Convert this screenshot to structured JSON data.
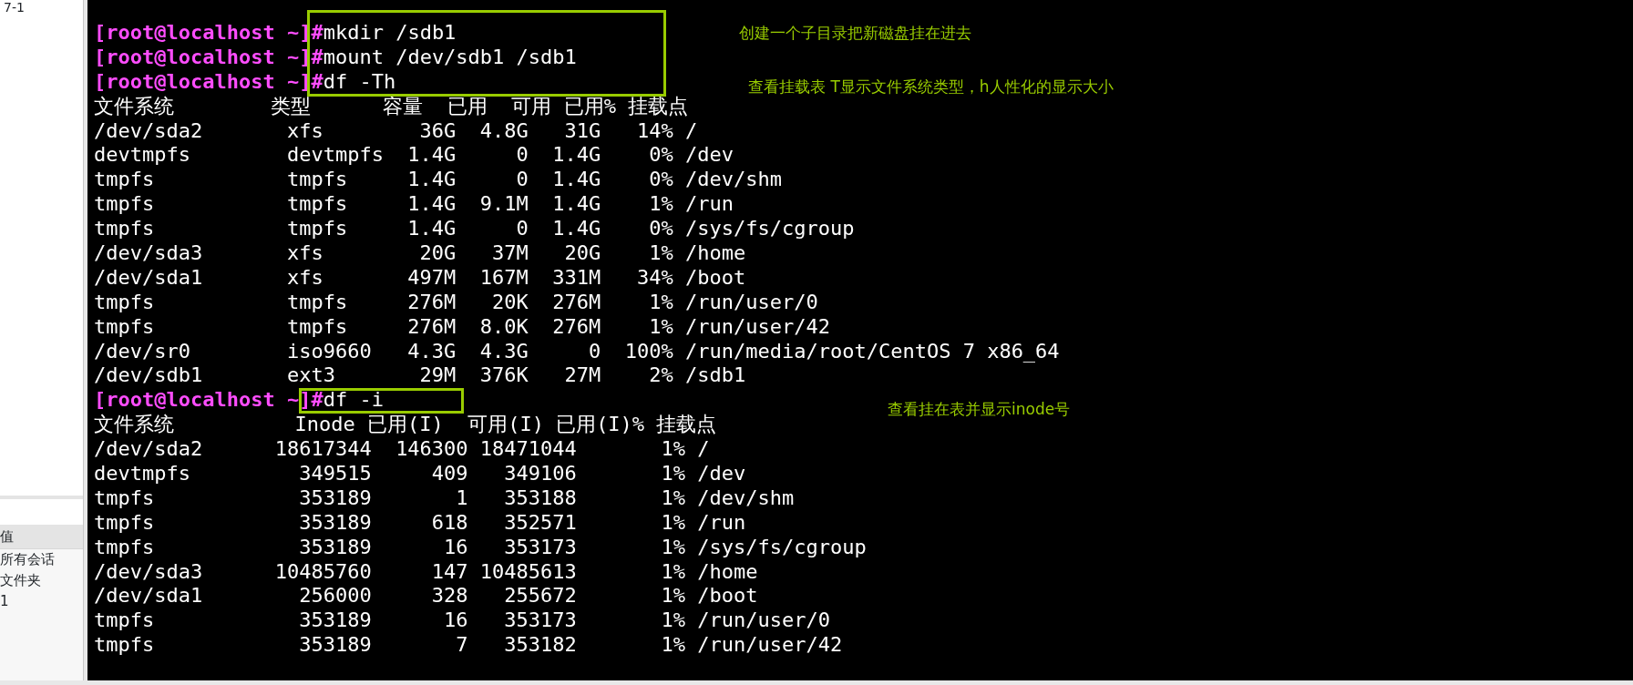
{
  "sidebar": {
    "top_text": "7-1",
    "header": "值",
    "items": [
      {
        "label": "所有会话"
      },
      {
        "label": "文件夹"
      },
      {
        "label": "1"
      }
    ]
  },
  "terminal": {
    "lines": [
      {
        "kind": "prompt",
        "prompt": "[root@localhost ~]#",
        "command": "mkdir /sdb1"
      },
      {
        "kind": "prompt",
        "prompt": "[root@localhost ~]#",
        "command": "mount /dev/sdb1 /sdb1"
      },
      {
        "kind": "prompt",
        "prompt": "[root@localhost ~]#",
        "command": "df -Th"
      },
      {
        "kind": "output",
        "text": "文件系统        类型      容量  已用  可用 已用% 挂载点"
      },
      {
        "kind": "output",
        "text": "/dev/sda2       xfs        36G  4.8G   31G   14% /"
      },
      {
        "kind": "output",
        "text": "devtmpfs        devtmpfs  1.4G     0  1.4G    0% /dev"
      },
      {
        "kind": "output",
        "text": "tmpfs           tmpfs     1.4G     0  1.4G    0% /dev/shm"
      },
      {
        "kind": "output",
        "text": "tmpfs           tmpfs     1.4G  9.1M  1.4G    1% /run"
      },
      {
        "kind": "output",
        "text": "tmpfs           tmpfs     1.4G     0  1.4G    0% /sys/fs/cgroup"
      },
      {
        "kind": "output",
        "text": "/dev/sda3       xfs        20G   37M   20G    1% /home"
      },
      {
        "kind": "output",
        "text": "/dev/sda1       xfs       497M  167M  331M   34% /boot"
      },
      {
        "kind": "output",
        "text": "tmpfs           tmpfs     276M   20K  276M    1% /run/user/0"
      },
      {
        "kind": "output",
        "text": "tmpfs           tmpfs     276M  8.0K  276M    1% /run/user/42"
      },
      {
        "kind": "output",
        "text": "/dev/sr0        iso9660   4.3G  4.3G     0  100% /run/media/root/CentOS 7 x86_64"
      },
      {
        "kind": "output",
        "text": "/dev/sdb1       ext3       29M  376K   27M    2% /sdb1"
      },
      {
        "kind": "prompt",
        "prompt": "[root@localhost ~]#",
        "command": "df -i"
      },
      {
        "kind": "output",
        "text": "文件系统          Inode 已用(I)  可用(I) 已用(I)% 挂载点"
      },
      {
        "kind": "output",
        "text": "/dev/sda2      18617344  146300 18471044       1% /"
      },
      {
        "kind": "output",
        "text": "devtmpfs         349515     409   349106       1% /dev"
      },
      {
        "kind": "output",
        "text": "tmpfs            353189       1   353188       1% /dev/shm"
      },
      {
        "kind": "output",
        "text": "tmpfs            353189     618   352571       1% /run"
      },
      {
        "kind": "output",
        "text": "tmpfs            353189      16   353173       1% /sys/fs/cgroup"
      },
      {
        "kind": "output",
        "text": "/dev/sda3      10485760     147 10485613       1% /home"
      },
      {
        "kind": "output",
        "text": "/dev/sda1        256000     328   255672       1% /boot"
      },
      {
        "kind": "output",
        "text": "tmpfs            353189      16   353173       1% /run/user/0"
      },
      {
        "kind": "output",
        "text": "tmpfs            353189       7   353182       1% /run/user/42"
      }
    ]
  },
  "annotations": [
    {
      "text": "创建一个子目录把新磁盘挂在进去"
    },
    {
      "text": "查看挂载表   T显示文件系统类型，h人性化的显示大小"
    },
    {
      "text": "查看挂在表并显示inode号"
    }
  ]
}
